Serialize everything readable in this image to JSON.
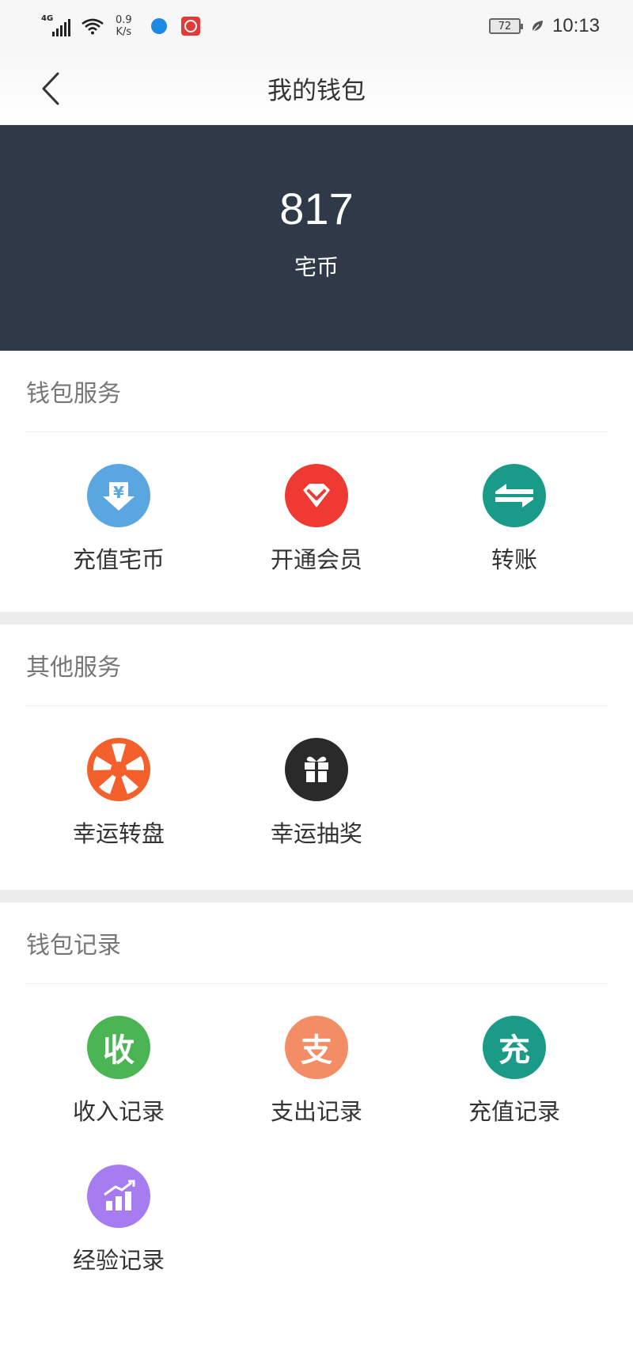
{
  "status_bar": {
    "network": "4G",
    "speed_value": "0.9",
    "speed_unit": "K/s",
    "battery": "72",
    "time": "10:13"
  },
  "nav": {
    "title": "我的钱包"
  },
  "balance": {
    "value": "817",
    "unit": "宅币"
  },
  "sections": {
    "wallet_services": {
      "title": "钱包服务",
      "items": [
        {
          "label": "充值宅币",
          "icon": "yen-download-icon",
          "color": "#5aa6e0"
        },
        {
          "label": "开通会员",
          "icon": "vip-diamond-icon",
          "color": "#ee3a33"
        },
        {
          "label": "转账",
          "icon": "transfer-arrows-icon",
          "color": "#1a9a88"
        }
      ]
    },
    "other_services": {
      "title": "其他服务",
      "items": [
        {
          "label": "幸运转盘",
          "icon": "lucky-wheel-icon",
          "color": "#f4602c"
        },
        {
          "label": "幸运抽奖",
          "icon": "gift-icon",
          "color": "#2a2a2a"
        }
      ]
    },
    "wallet_records": {
      "title": "钱包记录",
      "items": [
        {
          "label": "收入记录",
          "glyph": "收",
          "icon": "income-icon",
          "color": "#4bb454"
        },
        {
          "label": "支出记录",
          "glyph": "支",
          "icon": "expense-icon",
          "color": "#f38d65"
        },
        {
          "label": "充值记录",
          "glyph": "充",
          "icon": "recharge-icon",
          "color": "#1b9a87"
        },
        {
          "label": "经验记录",
          "icon": "experience-chart-icon",
          "color": "#a77cf0"
        }
      ]
    }
  }
}
